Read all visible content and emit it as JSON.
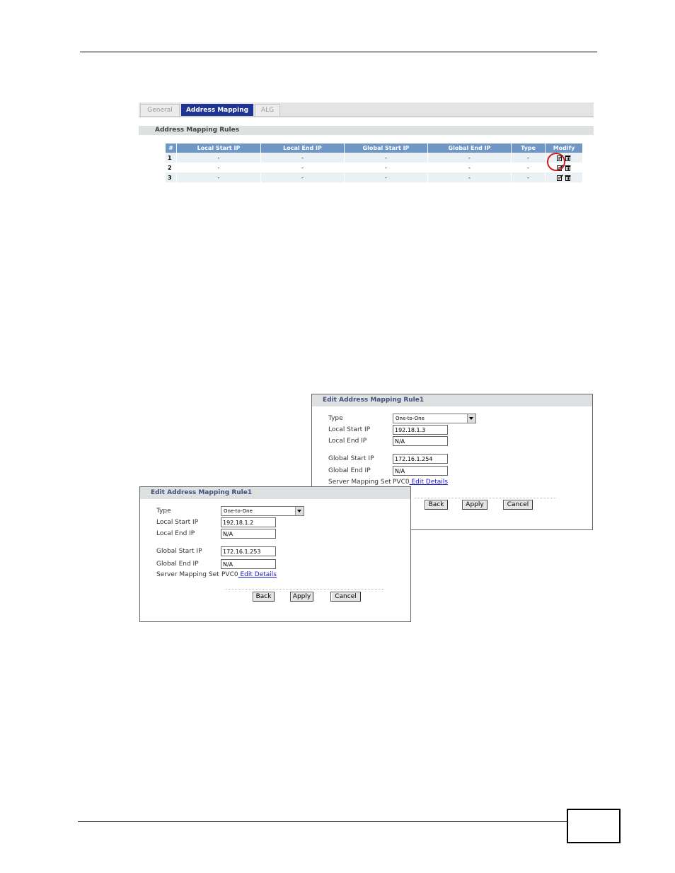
{
  "tabs": [
    "General",
    "Address Mapping",
    "ALG"
  ],
  "rules": {
    "section_title": "Address Mapping Rules",
    "columns": [
      "#",
      "Local Start IP",
      "Local End IP",
      "Global Start IP",
      "Global End IP",
      "Type",
      "Modify"
    ],
    "rows": [
      {
        "num": "1",
        "cells": [
          "-",
          "-",
          "-",
          "-",
          "-"
        ]
      },
      {
        "num": "2",
        "cells": [
          "-",
          "-",
          "-",
          "-",
          "-"
        ]
      },
      {
        "num": "3",
        "cells": [
          "-",
          "-",
          "-",
          "-",
          "-"
        ]
      }
    ],
    "modify_icons": [
      "edit-icon",
      "trash-icon"
    ]
  },
  "panel_a": {
    "title": "Edit Address Mapping Rule1",
    "type_label": "Type",
    "type_value": "One-to-One",
    "local_start_label": "Local Start IP",
    "local_start_value": "192.18.1.3",
    "local_end_label": "Local End IP",
    "local_end_value": "N/A",
    "global_start_label": "Global Start IP",
    "global_start_value": "172.16.1.254",
    "global_end_label": "Global End IP",
    "global_end_value": "N/A",
    "server_set_label": "Server Mapping Set",
    "server_set_value": "PVC0",
    "edit_details": " Edit Details",
    "back": "Back",
    "apply": "Apply",
    "cancel": "Cancel"
  },
  "panel_b": {
    "title": "Edit Address Mapping Rule1",
    "type_label": "Type",
    "type_value": "One-to-One",
    "local_start_label": "Local Start IP",
    "local_start_value": "192.18.1.2",
    "local_end_label": "Local End IP",
    "local_end_value": "N/A",
    "global_start_label": "Global Start IP",
    "global_start_value": "172.16.1.253",
    "global_end_label": "Global End IP",
    "global_end_value": "N/A",
    "server_set_label": "Server Mapping Set",
    "server_set_value": "PVC0",
    "edit_details": " Edit Details",
    "back": "Back",
    "apply": "Apply",
    "cancel": "Cancel"
  },
  "colors": {
    "tab_active": "#1f3591",
    "table_header": "#6f96c4",
    "highlight_ring": "#d01d1d",
    "link": "#1a1ad0"
  }
}
